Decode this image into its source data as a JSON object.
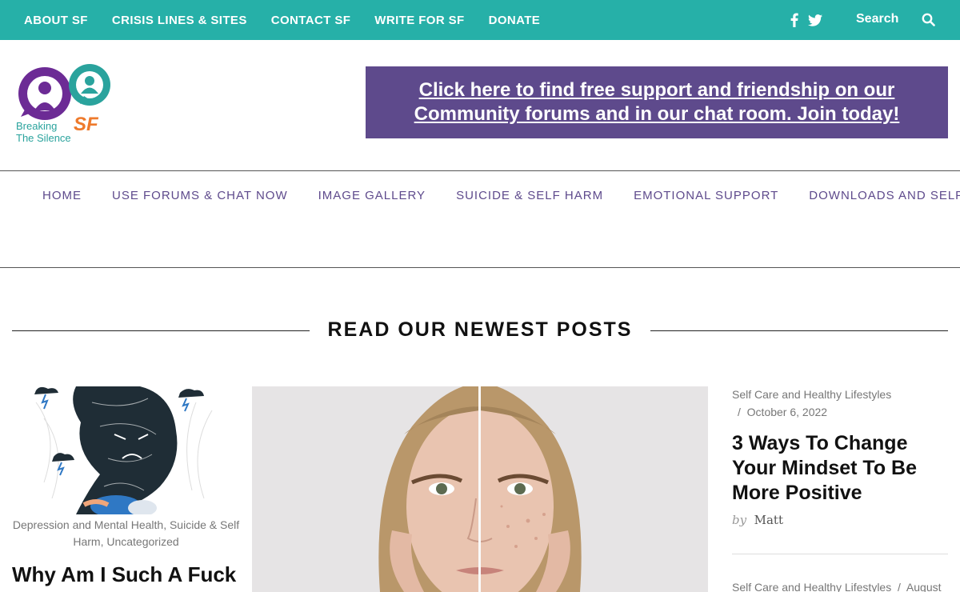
{
  "topbar": {
    "nav": [
      "ABOUT SF",
      "CRISIS LINES & SITES",
      "CONTACT SF",
      "WRITE FOR SF",
      "DONATE"
    ],
    "search_label": "Search",
    "social": [
      "facebook-icon",
      "twitter-icon"
    ],
    "color": "#26b0a8"
  },
  "logo": {
    "line1": "Breaking",
    "line2": "The Silence",
    "mark": "SF"
  },
  "promo": {
    "text": "Click here to find free support and friendship on our Community forums and in our chat room. Join today!",
    "color": "#5e4a8c"
  },
  "mainnav": {
    "items": [
      "HOME",
      "USE FORUMS & CHAT NOW",
      "IMAGE GALLERY",
      "SUICIDE & SELF HARM",
      "EMOTIONAL SUPPORT",
      "DOWNLOADS AND SELF HELP"
    ]
  },
  "section": {
    "title": "READ OUR NEWEST POSTS"
  },
  "posts": {
    "left": {
      "categories": "Depression and Mental Health, Suicide & Self Harm, Uncategorized",
      "title": "Why Am I Such A Fuck"
    },
    "right": {
      "category": "Self Care and Healthy Lifestyles",
      "date_sep": "/",
      "date": "October 6, 2022",
      "title": "3 Ways To Change Your Mindset To Be More Positive",
      "by": "by",
      "author": "Matt",
      "next_category": "Self Care and Healthy Lifestyles",
      "next_date": "August"
    }
  }
}
